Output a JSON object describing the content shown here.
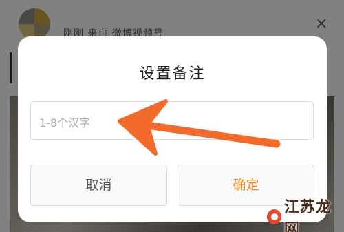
{
  "background": {
    "meta_text": "刚刚  来自 微博视频号",
    "close_glyph": "×"
  },
  "dialog": {
    "title": "设置备注",
    "input_placeholder": "1-8个汉字",
    "cancel_label": "取消",
    "confirm_label": "确定",
    "accent_color": "#f48a23"
  },
  "annotation": {
    "arrow_color": "#f26b2c"
  },
  "watermark": {
    "text": "江苏龙网"
  }
}
